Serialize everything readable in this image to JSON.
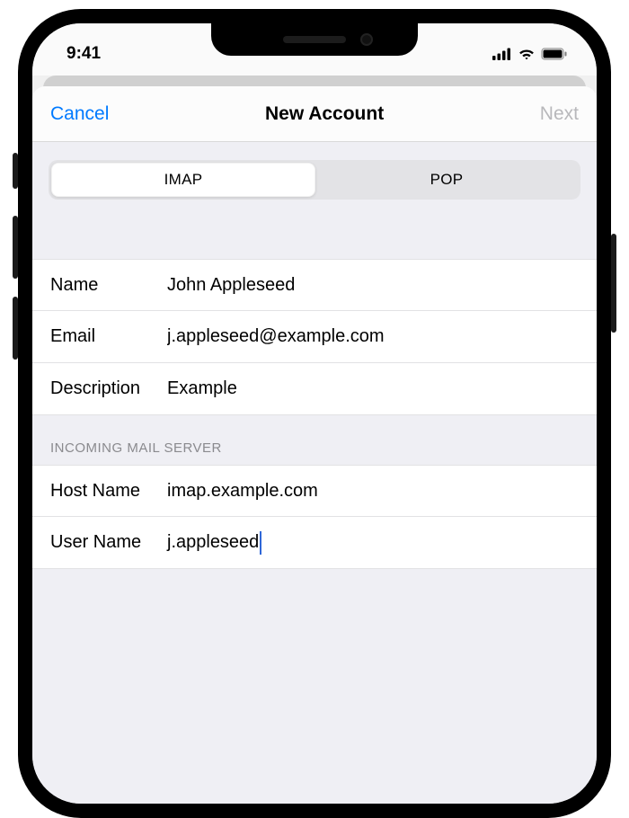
{
  "status": {
    "time": "9:41"
  },
  "nav": {
    "cancel": "Cancel",
    "title": "New Account",
    "next": "Next"
  },
  "segmented": {
    "imap": "IMAP",
    "pop": "POP",
    "selected": "IMAP"
  },
  "account": {
    "name_label": "Name",
    "name_value": "John Appleseed",
    "email_label": "Email",
    "email_value": "j.appleseed@example.com",
    "description_label": "Description",
    "description_value": "Example"
  },
  "incoming": {
    "header": "Incoming Mail Server",
    "hostname_label": "Host Name",
    "hostname_value": "imap.example.com",
    "username_label": "User Name",
    "username_value": "j.appleseed"
  }
}
